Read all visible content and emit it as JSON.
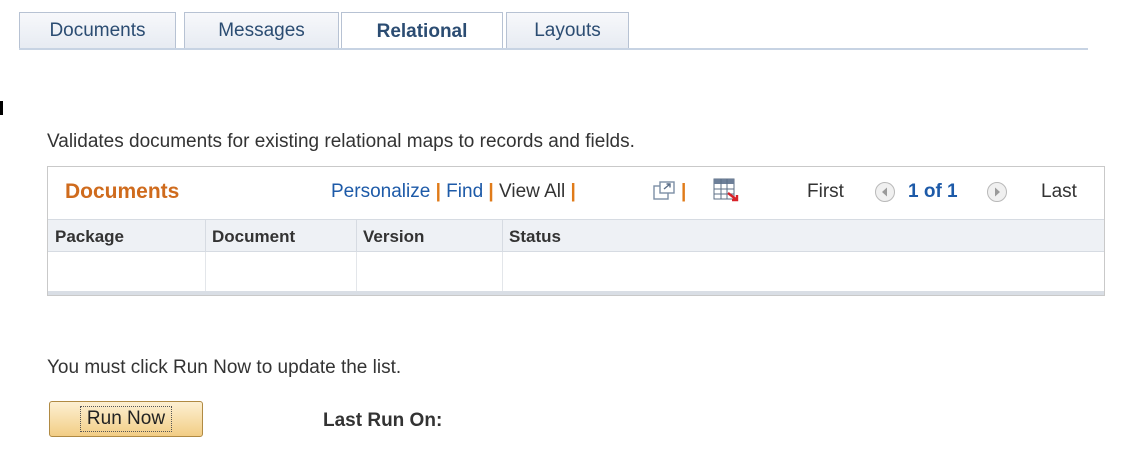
{
  "tabs": [
    {
      "label": "Documents",
      "active": false
    },
    {
      "label": "Messages",
      "active": false
    },
    {
      "label": "Relational",
      "active": true
    },
    {
      "label": "Layouts",
      "active": false
    }
  ],
  "description": "Validates documents for existing relational maps to records and fields.",
  "grid": {
    "title": "Documents",
    "personalize": "Personalize",
    "find": "Find",
    "view_all": "View All",
    "separator": "|",
    "first": "First",
    "page_info": "1 of 1",
    "last": "Last",
    "columns": [
      "Package",
      "Document",
      "Version",
      "Status"
    ],
    "rows": [
      [
        "",
        "",
        "",
        ""
      ]
    ]
  },
  "note": "You must click Run Now to update the list.",
  "run_button": "Run Now",
  "last_run_label": "Last Run On:",
  "colors": {
    "grid_title": "#cf6b1d",
    "link": "#1d5aa8",
    "tab_text": "#2b4c72",
    "button_bg": "#f2cd85"
  },
  "icons": [
    "zoom-icon",
    "download-grid-icon",
    "previous-arrow-icon",
    "next-arrow-icon"
  ]
}
